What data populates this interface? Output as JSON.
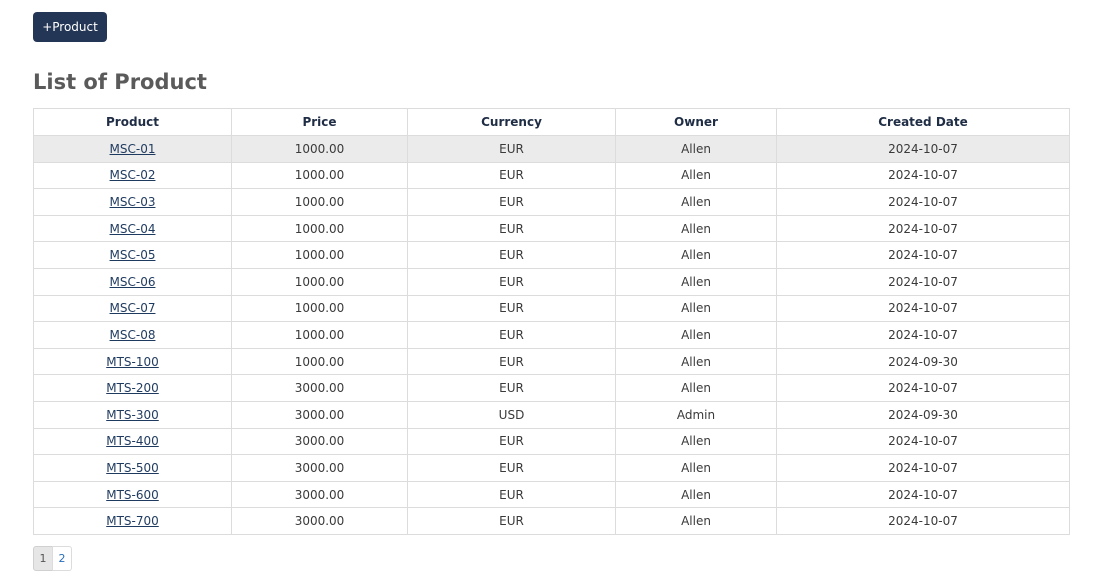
{
  "toolbar": {
    "add_label": "+Product"
  },
  "page": {
    "title": "List of Product"
  },
  "table": {
    "columns": [
      "Product",
      "Price",
      "Currency",
      "Owner",
      "Created Date"
    ],
    "rows": [
      {
        "product": "MSC-01",
        "price": "1000.00",
        "currency": "EUR",
        "owner": "Allen",
        "created": "2024-10-07"
      },
      {
        "product": "MSC-02",
        "price": "1000.00",
        "currency": "EUR",
        "owner": "Allen",
        "created": "2024-10-07"
      },
      {
        "product": "MSC-03",
        "price": "1000.00",
        "currency": "EUR",
        "owner": "Allen",
        "created": "2024-10-07"
      },
      {
        "product": "MSC-04",
        "price": "1000.00",
        "currency": "EUR",
        "owner": "Allen",
        "created": "2024-10-07"
      },
      {
        "product": "MSC-05",
        "price": "1000.00",
        "currency": "EUR",
        "owner": "Allen",
        "created": "2024-10-07"
      },
      {
        "product": "MSC-06",
        "price": "1000.00",
        "currency": "EUR",
        "owner": "Allen",
        "created": "2024-10-07"
      },
      {
        "product": "MSC-07",
        "price": "1000.00",
        "currency": "EUR",
        "owner": "Allen",
        "created": "2024-10-07"
      },
      {
        "product": "MSC-08",
        "price": "1000.00",
        "currency": "EUR",
        "owner": "Allen",
        "created": "2024-10-07"
      },
      {
        "product": "MTS-100",
        "price": "1000.00",
        "currency": "EUR",
        "owner": "Allen",
        "created": "2024-09-30"
      },
      {
        "product": "MTS-200",
        "price": "3000.00",
        "currency": "EUR",
        "owner": "Allen",
        "created": "2024-10-07"
      },
      {
        "product": "MTS-300",
        "price": "3000.00",
        "currency": "USD",
        "owner": "Admin",
        "created": "2024-09-30"
      },
      {
        "product": "MTS-400",
        "price": "3000.00",
        "currency": "EUR",
        "owner": "Allen",
        "created": "2024-10-07"
      },
      {
        "product": "MTS-500",
        "price": "3000.00",
        "currency": "EUR",
        "owner": "Allen",
        "created": "2024-10-07"
      },
      {
        "product": "MTS-600",
        "price": "3000.00",
        "currency": "EUR",
        "owner": "Allen",
        "created": "2024-10-07"
      },
      {
        "product": "MTS-700",
        "price": "3000.00",
        "currency": "EUR",
        "owner": "Allen",
        "created": "2024-10-07"
      }
    ]
  },
  "pagination": {
    "pages": [
      "1",
      "2"
    ],
    "current": "1"
  },
  "colors": {
    "button_bg": "#243655",
    "hover_row": "#ebebeb",
    "link": "#1f3a5f"
  }
}
